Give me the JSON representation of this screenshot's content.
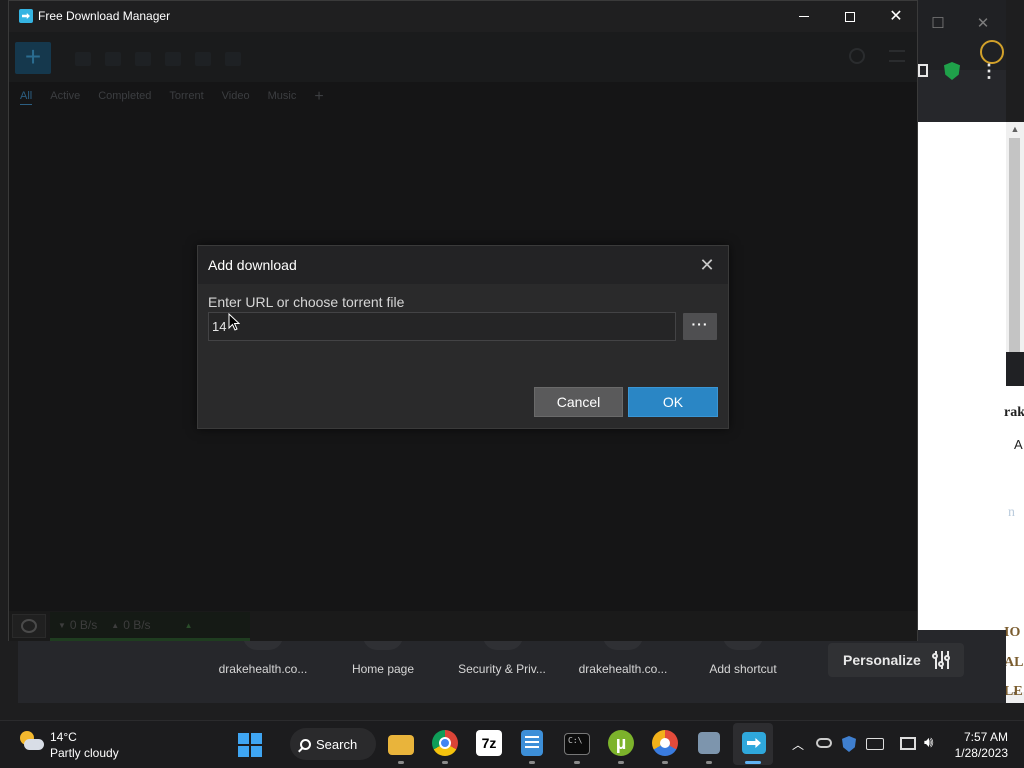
{
  "fdm": {
    "title": "Free Download Manager",
    "tabs": [
      {
        "label": "All",
        "active": true
      },
      {
        "label": "Active",
        "active": false
      },
      {
        "label": "Completed",
        "active": false
      },
      {
        "label": "Torrent",
        "active": false
      },
      {
        "label": "Video",
        "active": false
      },
      {
        "label": "Music",
        "active": false
      }
    ],
    "tab_add": "+",
    "status": {
      "download_speed": "0 B/s",
      "upload_speed": "0 B/s"
    }
  },
  "dialog": {
    "title": "Add download",
    "label": "Enter URL or choose torrent file",
    "url_value": "14",
    "browse_label": "···",
    "cancel_label": "Cancel",
    "ok_label": "OK"
  },
  "browser": {
    "shortcuts": [
      {
        "label": "drakehealth.co..."
      },
      {
        "label": "Home page"
      },
      {
        "label": "Security & Priv..."
      },
      {
        "label": "drakehealth.co..."
      },
      {
        "label": "Add shortcut"
      }
    ],
    "personalize_label": "Personalize",
    "page_fragments": [
      "rak",
      "A",
      "n",
      "IO",
      "AL",
      "LE"
    ]
  },
  "taskbar": {
    "weather_temp": "14°C",
    "weather_desc": "Partly cloudy",
    "search_label": "Search",
    "sevenzip_label": "7z",
    "time": "7:57 AM",
    "date": "1/28/2023"
  },
  "colors": {
    "accent": "#2a86c5",
    "fdm_bg": "#151516",
    "dialog_bg": "#2a2a2b",
    "speed_bar": "#1f3d20"
  }
}
